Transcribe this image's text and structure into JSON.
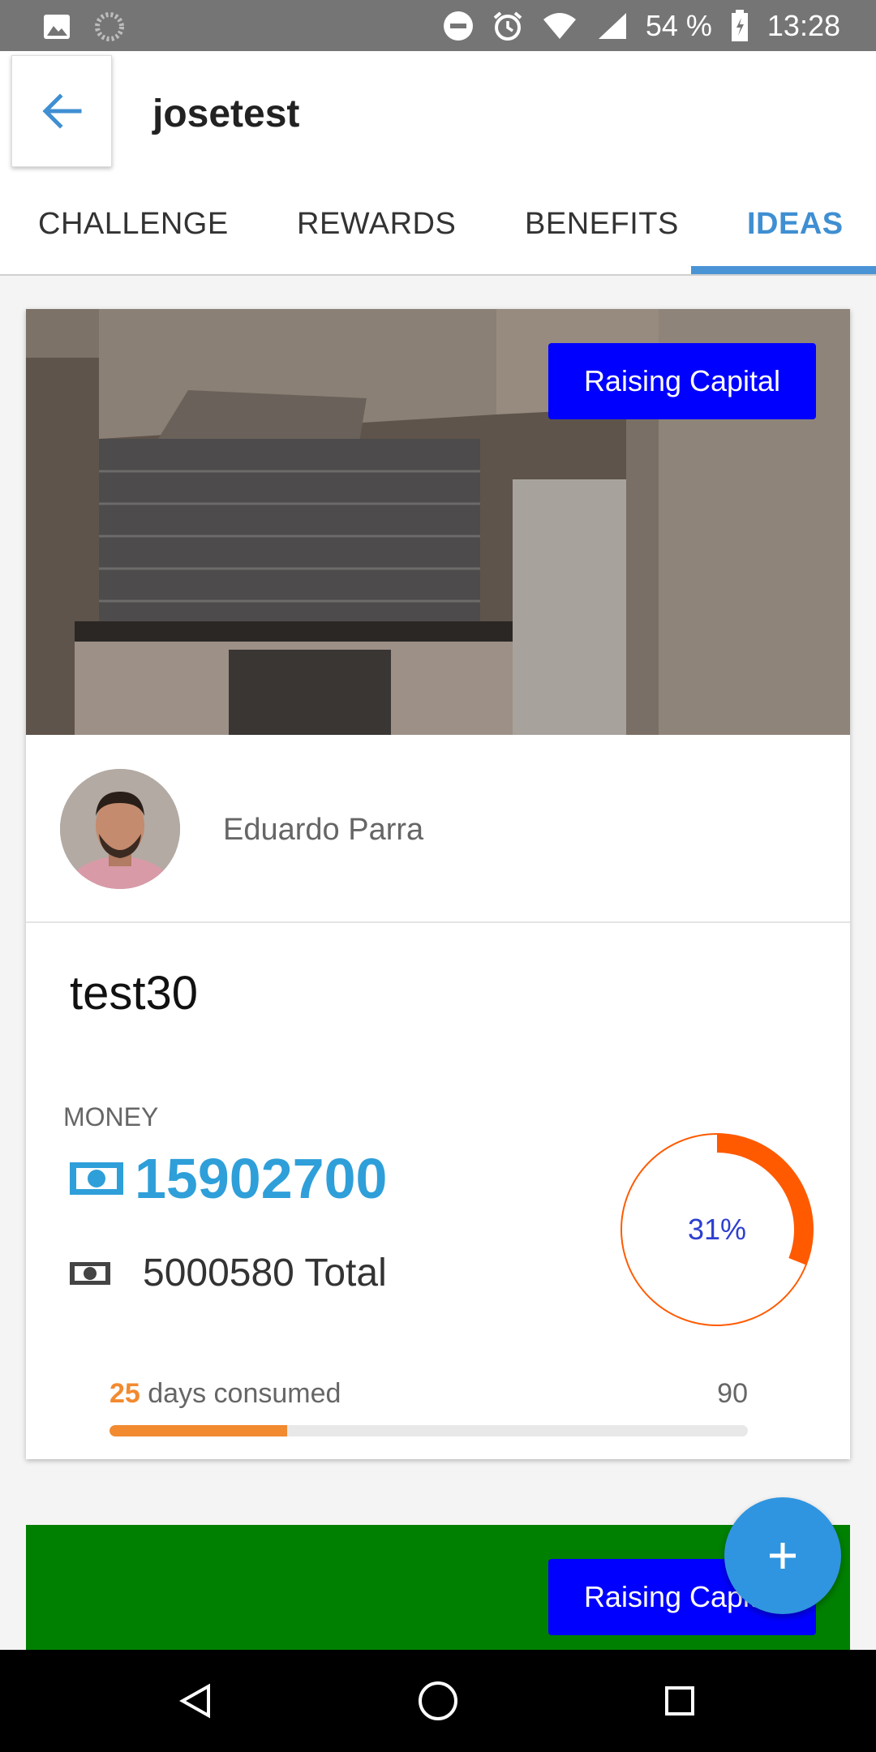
{
  "status_bar": {
    "battery": "54 %",
    "time": "13:28",
    "icons": [
      "image-icon",
      "loading-icon",
      "do-not-disturb-icon",
      "alarm-icon",
      "wifi-icon",
      "signal-icon",
      "battery-icon"
    ]
  },
  "app_bar": {
    "title": "josetest",
    "back_icon": "arrow-back-icon"
  },
  "tabs": [
    {
      "label": "CHALLENGE",
      "active": false
    },
    {
      "label": "REWARDS",
      "active": false
    },
    {
      "label": "BENEFITS",
      "active": false
    },
    {
      "label": "IDEAS",
      "active": true
    }
  ],
  "idea_card": {
    "status": "Raising Capital",
    "owner_name": "Eduardo Parra",
    "title": "test30",
    "money_label": "MONEY",
    "money_value": "15902700",
    "total_value": "5000580 Total",
    "percent_label": "31%",
    "percent": 0.31,
    "days_consumed": "25",
    "days_label": " days consumed",
    "days_total": "90",
    "days_fraction": 0.278,
    "colors": {
      "status_tag": "#0000ff",
      "money": "#2f9fd9",
      "donut": "#ff5a00",
      "progress": "#f28a30"
    }
  },
  "second_card": {
    "status": "Raising Capital",
    "color": "#008000"
  },
  "fab": {
    "icon": "plus-icon"
  },
  "nav_bar": {
    "icons": [
      "back-triangle-icon",
      "home-circle-icon",
      "recents-square-icon"
    ]
  }
}
